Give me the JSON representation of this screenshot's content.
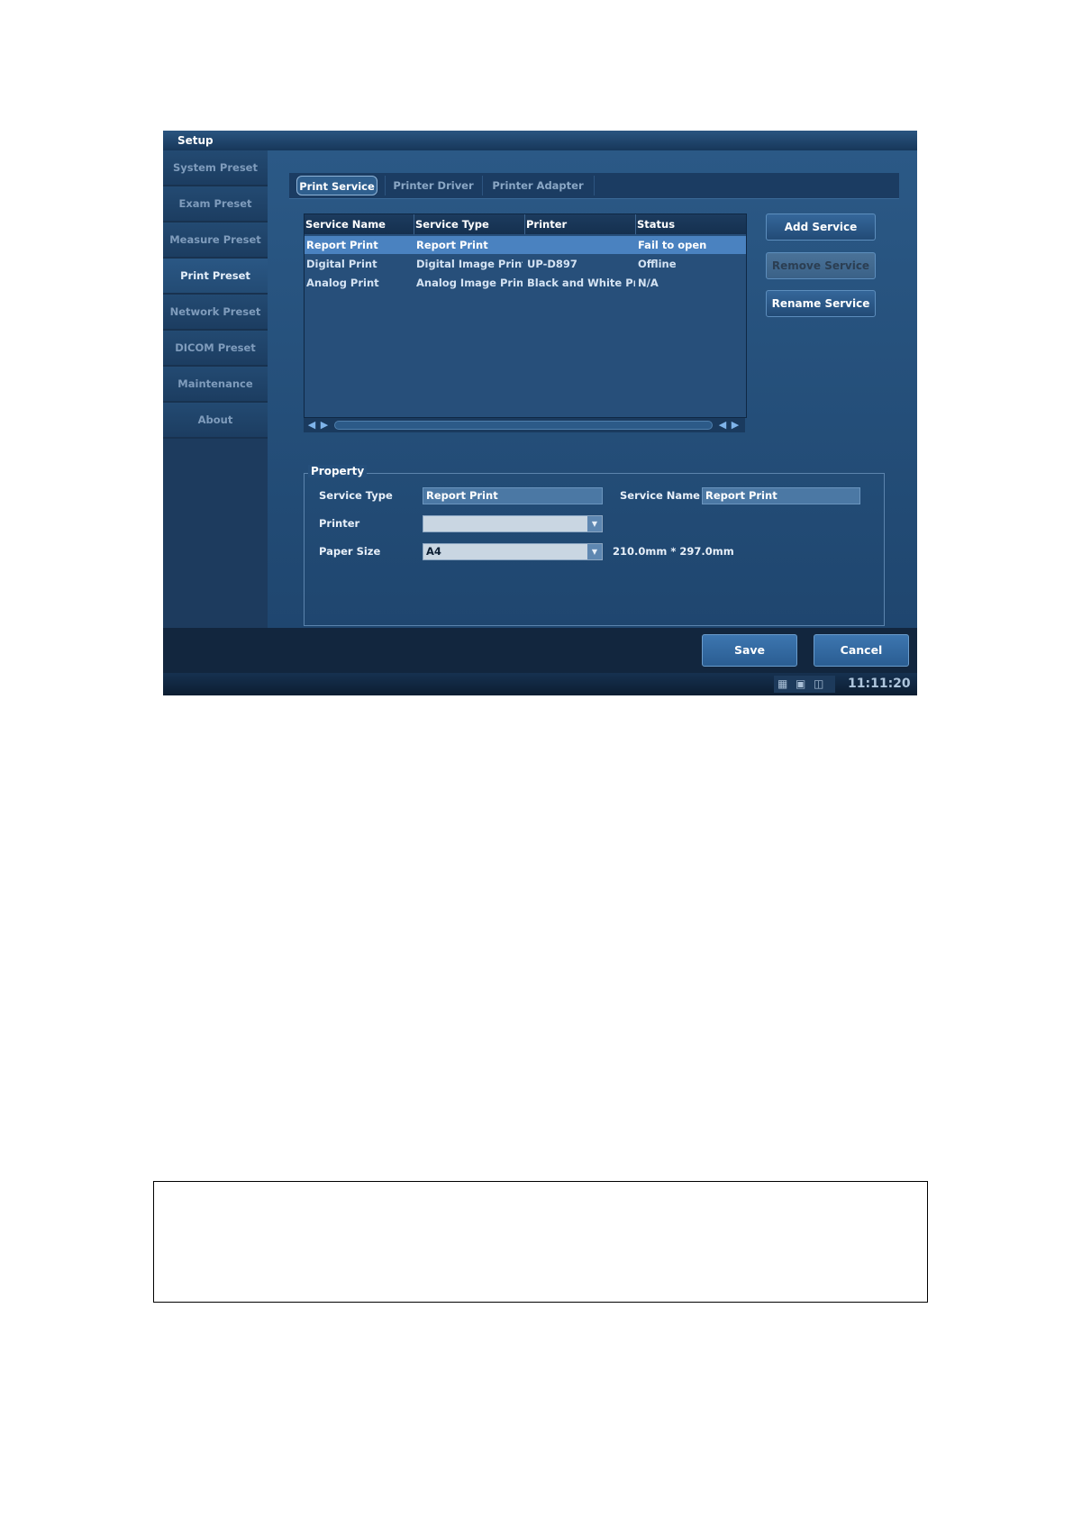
{
  "window": {
    "title": "Setup"
  },
  "sidebar": {
    "items": [
      {
        "label": "System Preset"
      },
      {
        "label": "Exam Preset"
      },
      {
        "label": "Measure Preset"
      },
      {
        "label": "Print Preset",
        "active": true
      },
      {
        "label": "Network Preset"
      },
      {
        "label": "DICOM Preset"
      },
      {
        "label": "Maintenance"
      },
      {
        "label": "About"
      }
    ]
  },
  "tabs": [
    {
      "label": "Print Service",
      "active": true
    },
    {
      "label": "Printer Driver"
    },
    {
      "label": "Printer Adapter"
    }
  ],
  "service_table": {
    "columns": [
      "Service Name",
      "Service Type",
      "Printer",
      "Status"
    ],
    "rows": [
      {
        "name": "Report Print",
        "type": "Report Print",
        "printer": "",
        "status": "Fail to open",
        "selected": true
      },
      {
        "name": "Digital Print",
        "type": "Digital Image Print",
        "printer": "UP-D897",
        "status": "Offline"
      },
      {
        "name": "Analog Print",
        "type": "Analog Image Print",
        "printer": "Black and White Pri...",
        "status": "N/A"
      }
    ]
  },
  "actions": {
    "add_service": "Add Service",
    "remove_service": "Remove Service",
    "rename_service": "Rename Service"
  },
  "property": {
    "legend": "Property",
    "service_type_label": "Service Type",
    "service_type_value": "Report Print",
    "service_name_label": "Service Name",
    "service_name_value": "Report Print",
    "printer_label": "Printer",
    "printer_value": "",
    "paper_size_label": "Paper Size",
    "paper_size_value": "A4",
    "paper_dimensions": "210.0mm * 297.0mm"
  },
  "footer": {
    "save": "Save",
    "cancel": "Cancel"
  },
  "status_bar": {
    "clock": "11:11:20"
  },
  "icons": {
    "scroll_left": "triangle-left",
    "scroll_right": "triangle-right",
    "dropdown": "triangle-down"
  },
  "colors": {
    "window_bg": "#1f4268",
    "selected_row": "#4a82c0",
    "button": "#2a5d92"
  }
}
